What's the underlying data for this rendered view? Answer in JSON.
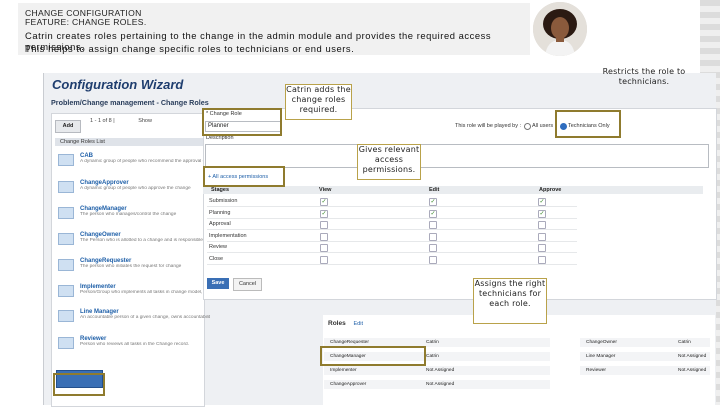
{
  "header": {
    "line1": "CHANGE CONFIGURATION",
    "line2": "FEATURE: CHANGE ROLES.",
    "desc1": "Catrin creates roles pertaining to the change in the admin module and provides the required access permissions.",
    "desc2": "This helps to assign change specific roles to technicians or end users."
  },
  "wizard": {
    "title": "Configuration Wizard",
    "breadcrumb": "Problem/Change management - Change Roles",
    "add_label": "Add",
    "pager": "1 - 1 of 8 |",
    "show_label": "Show",
    "list_header": "Change Roles List",
    "roles": [
      {
        "name": "CAB",
        "desc": "A dynamic group of people who recommend the approval of a change"
      },
      {
        "name": "ChangeApprover",
        "desc": "A dynamic group of people who approve the change"
      },
      {
        "name": "ChangeManager",
        "desc": "The person who manages/control the change"
      },
      {
        "name": "ChangeOwner",
        "desc": "The Person who is allotted to a change and is responsible"
      },
      {
        "name": "ChangeRequester",
        "desc": "The person who initiates the request for change"
      },
      {
        "name": "Implementer",
        "desc": "Person/Group who implements all tasks in change model, in the implementation"
      },
      {
        "name": "Line Manager",
        "desc": "An accountable person of a given change, owns accountability in the change's life cycle"
      },
      {
        "name": "Reviewer",
        "desc": "Person who reviews all tasks in the Change record."
      }
    ]
  },
  "form": {
    "role_label": "* Change Role",
    "role_value": "Planner",
    "played_by_label": "This role will be played by :",
    "option_all": "All users",
    "option_tech": "Technicians Only",
    "description_label": "Description",
    "permissions_link": "+ All access permissions",
    "columns": [
      "Stages",
      "View",
      "Edit",
      "Approve"
    ],
    "stages": [
      {
        "name": "Submission",
        "view": true,
        "edit": true,
        "approve": true
      },
      {
        "name": "Planning",
        "view": true,
        "edit": true,
        "approve": true
      },
      {
        "name": "Approval",
        "view": false,
        "edit": false,
        "approve": false
      },
      {
        "name": "Implementation",
        "view": false,
        "edit": false,
        "approve": false
      },
      {
        "name": "Review",
        "view": false,
        "edit": false,
        "approve": false
      },
      {
        "name": "Close",
        "view": false,
        "edit": false,
        "approve": false
      }
    ],
    "save_label": "Save",
    "cancel_label": "Cancel"
  },
  "roles_panel": {
    "title": "Roles",
    "edit_link": "Edit",
    "col1": [
      {
        "role": "ChangeRequester",
        "value": "Catrin"
      },
      {
        "role": "ChangeManager",
        "value": "Catrin"
      },
      {
        "role": "Implementer",
        "value": "Not Assigned"
      },
      {
        "role": "ChangeApprover",
        "value": "Not Assigned"
      }
    ],
    "col2": [
      {
        "role": "ChangeOwner",
        "value": "Catrin"
      },
      {
        "role": "Line Manager",
        "value": "Not Assigned"
      },
      {
        "role": "Reviewer",
        "value": "Not Assigned"
      }
    ]
  },
  "callouts": {
    "restricts": "Restricts the role to technicians.",
    "adds": "Catrin adds the change roles required.",
    "gives": "Gives relevant access permissions.",
    "assigns": "Assigns the right technicians for each role."
  },
  "colors": {
    "highlight": "#8f7b2e",
    "callout_border": "#b9a24a",
    "accent_blue": "#3a6fb5"
  }
}
